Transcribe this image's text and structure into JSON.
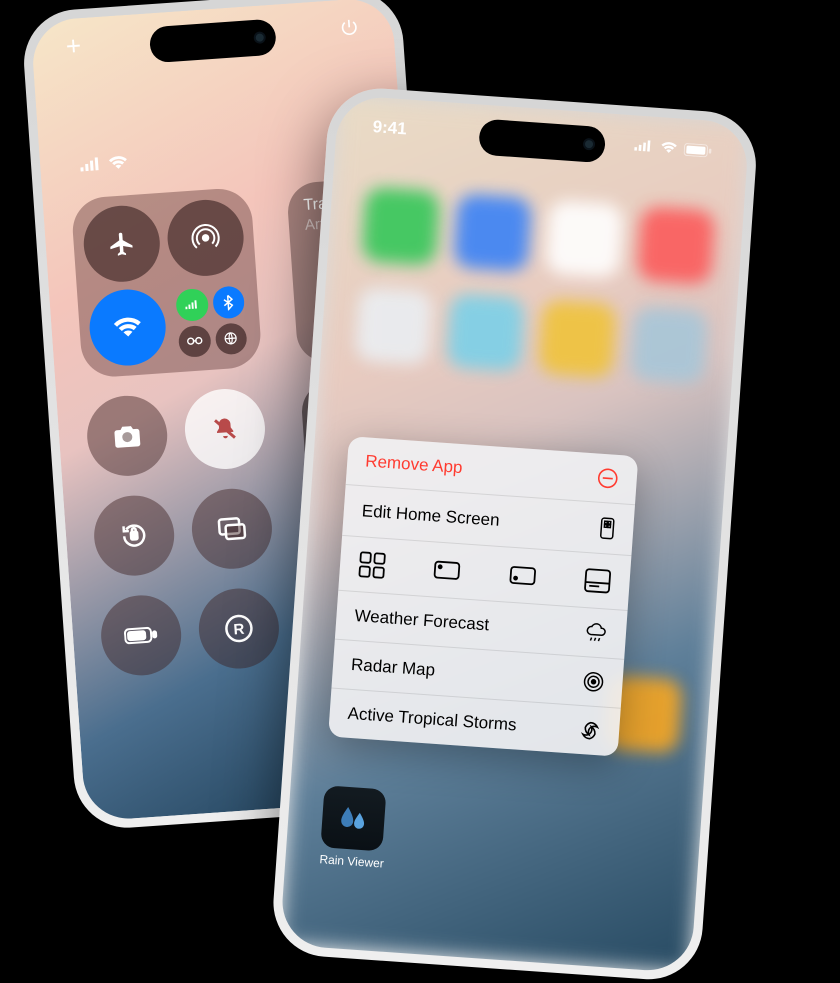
{
  "left_phone": {
    "music": {
      "title": "Track",
      "artist": "Artist"
    }
  },
  "right_phone": {
    "status_time": "9:41",
    "context_menu": {
      "remove": "Remove App",
      "edit": "Edit Home Screen",
      "forecast": "Weather Forecast",
      "radar": "Radar Map",
      "storms": "Active Tropical Storms"
    },
    "app": {
      "name": "Rain Viewer"
    }
  }
}
